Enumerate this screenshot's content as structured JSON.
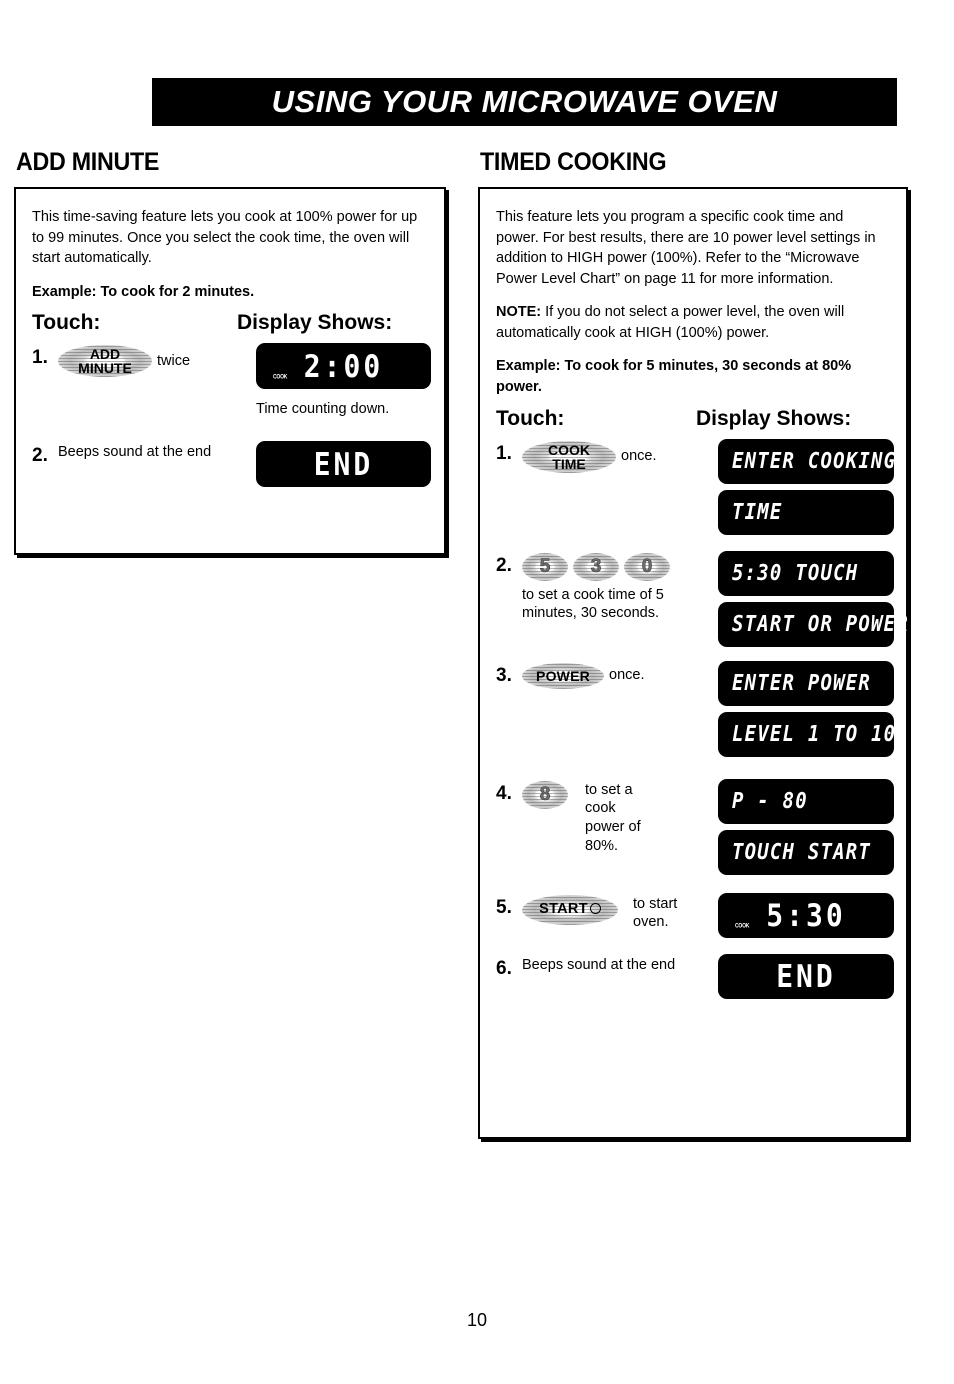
{
  "banner": {
    "title": "USING YOUR MICROWAVE OVEN"
  },
  "page": {
    "number": "10"
  },
  "left_section": {
    "heading": "ADD MINUTE",
    "intro": "This time-saving feature lets you cook at 100% power for up to 99 minutes. Once you select the cook time, the oven will start automatically.",
    "example": "Example: To cook for 2 minutes.",
    "col_touch": "Touch:",
    "col_display": "Display Shows:",
    "steps": [
      {
        "num": "1.",
        "button_label_line1": "ADD",
        "button_label_line2": "MINUTE",
        "after_text": "twice",
        "display": "2:00",
        "annunciator": "COOK",
        "caption": "Time counting down."
      },
      {
        "num": "2.",
        "text": "Beeps sound at the end",
        "display": "END"
      }
    ]
  },
  "right_section": {
    "heading": "TIMED COOKING",
    "intro": "This feature lets you program a specific cook time and power. For best results, there are 10 power level settings in addition to HIGH power (100%). Refer to the “Microwave Power Level Chart” on page 11 for more information.",
    "note_label": "NOTE:",
    "note_text": " If you do not select a power level, the oven will automatically cook at HIGH (100%) power.",
    "example": "Example: To cook for 5 minutes, 30 seconds at 80% power.",
    "col_touch": "Touch:",
    "col_display": "Display Shows:",
    "steps": [
      {
        "num": "1.",
        "button_label_line1": "COOK",
        "button_label_line2": "TIME",
        "after_text": "once.",
        "display_1": "ENTER COOKING",
        "display_2": "TIME"
      },
      {
        "num": "2.",
        "digits": [
          "5",
          "3",
          "0"
        ],
        "caption": "to set a cook time of 5 minutes, 30 seconds.",
        "display_1": "5:30 TOUCH",
        "display_2": "START OR POWER"
      },
      {
        "num": "3.",
        "button_label": "POWER",
        "after_text": "once.",
        "display_1": "ENTER POWER",
        "display_2": "LEVEL 1 TO 10"
      },
      {
        "num": "4.",
        "digits": [
          "8"
        ],
        "after_text": "to set a cook power of 80%.",
        "display_1": "P - 80",
        "display_2": "TOUCH START"
      },
      {
        "num": "5.",
        "button_label": "START",
        "after_text": "to start oven.",
        "display": "5:30",
        "annunciator": "COOK"
      },
      {
        "num": "6.",
        "text": "Beeps sound at the end",
        "display": "END"
      }
    ]
  }
}
